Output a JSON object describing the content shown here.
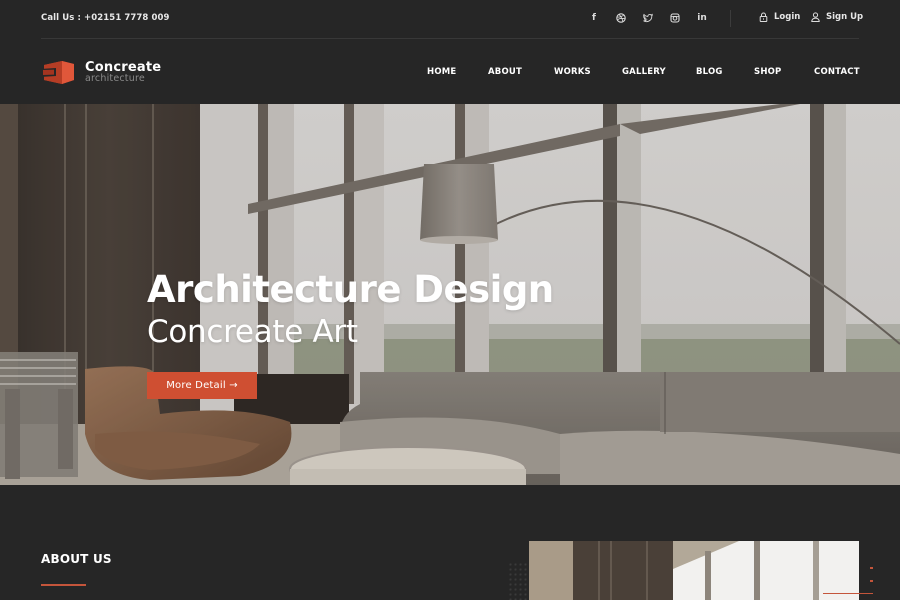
{
  "topbar": {
    "call_label": "Call Us : +02151 7778 009",
    "social": [
      {
        "name": "facebook-icon",
        "glyph": "f"
      },
      {
        "name": "dribbble-icon",
        "glyph": ""
      },
      {
        "name": "twitter-icon",
        "glyph": ""
      },
      {
        "name": "instagram-icon",
        "glyph": ""
      },
      {
        "name": "linkedin-icon",
        "glyph": "in"
      }
    ],
    "login_label": "Login",
    "signup_label": "Sign Up"
  },
  "brand": {
    "name": "Concreate",
    "tagline": "architecture",
    "accent": "#cf4f32"
  },
  "nav": {
    "items": [
      "HOME",
      "ABOUT",
      "WORKS",
      "GALLERY",
      "BLOG",
      "SHOP",
      "CONTACT"
    ]
  },
  "hero": {
    "title": "Architecture Design",
    "subtitle": "Concreate Art",
    "button_label": "More Detail →"
  },
  "about": {
    "heading": "ABOUT US"
  },
  "slider": {
    "count": 3,
    "active_index": 2
  }
}
